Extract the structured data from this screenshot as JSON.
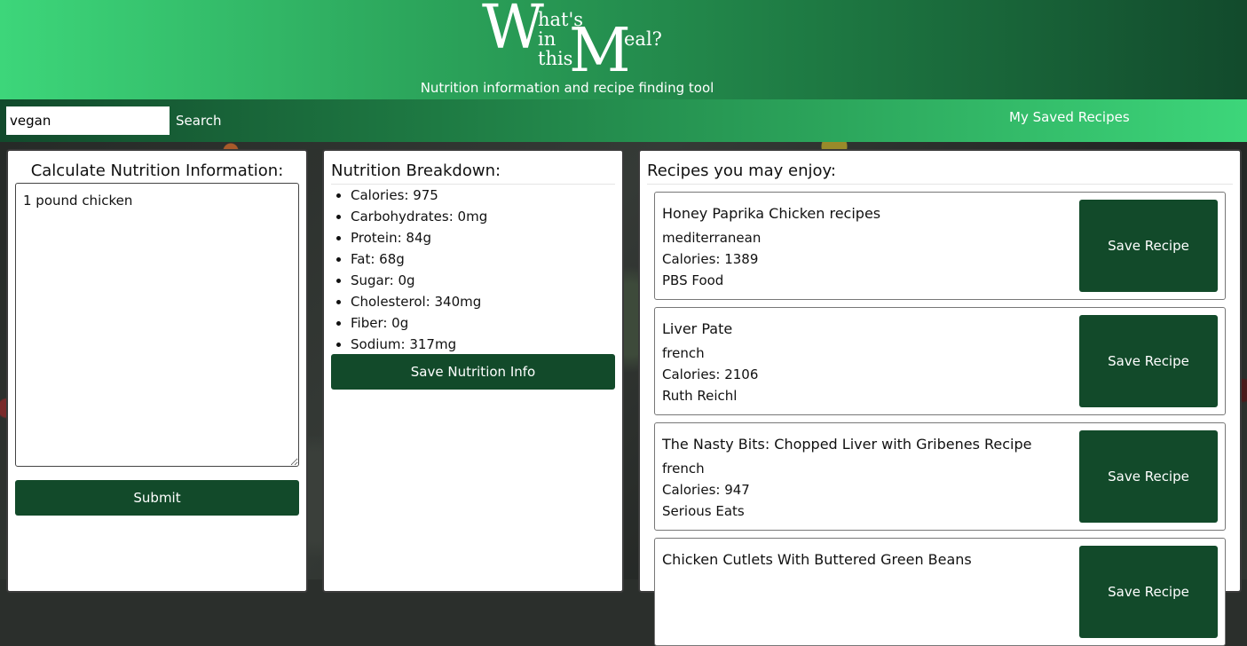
{
  "header": {
    "logo": {
      "w": "W",
      "hats": "hat's",
      "in": "in",
      "this": "this",
      "m": "M",
      "eal": "eal?"
    },
    "tagline": "Nutrition information and recipe finding tool"
  },
  "nav": {
    "search_value": "vegan",
    "search_button": "Search",
    "saved_link": "My Saved Recipes"
  },
  "calculator": {
    "title": "Calculate Nutrition Information:",
    "input_value": "1 pound chicken",
    "submit_label": "Submit"
  },
  "breakdown": {
    "title": "Nutrition Breakdown:",
    "items": [
      "Calories: 975",
      "Carbohydrates: 0mg",
      "Protein: 84g",
      "Fat: 68g",
      "Sugar: 0g",
      "Cholesterol: 340mg",
      "Fiber: 0g",
      "Sodium: 317mg"
    ],
    "save_label": "Save Nutrition Info"
  },
  "recipes": {
    "title": "Recipes you may enjoy:",
    "save_label": "Save Recipe",
    "items": [
      {
        "title": "Honey Paprika Chicken recipes",
        "cuisine": "mediterranean",
        "calories": "Calories: 1389",
        "source": "PBS Food"
      },
      {
        "title": "Liver Pate",
        "cuisine": "french",
        "calories": "Calories: 2106",
        "source": "Ruth Reichl"
      },
      {
        "title": "The Nasty Bits: Chopped Liver with Gribenes Recipe",
        "cuisine": "french",
        "calories": "Calories: 947",
        "source": "Serious Eats"
      },
      {
        "title": "Chicken Cutlets With Buttered Green Beans",
        "cuisine": "",
        "calories": "",
        "source": ""
      }
    ]
  }
}
